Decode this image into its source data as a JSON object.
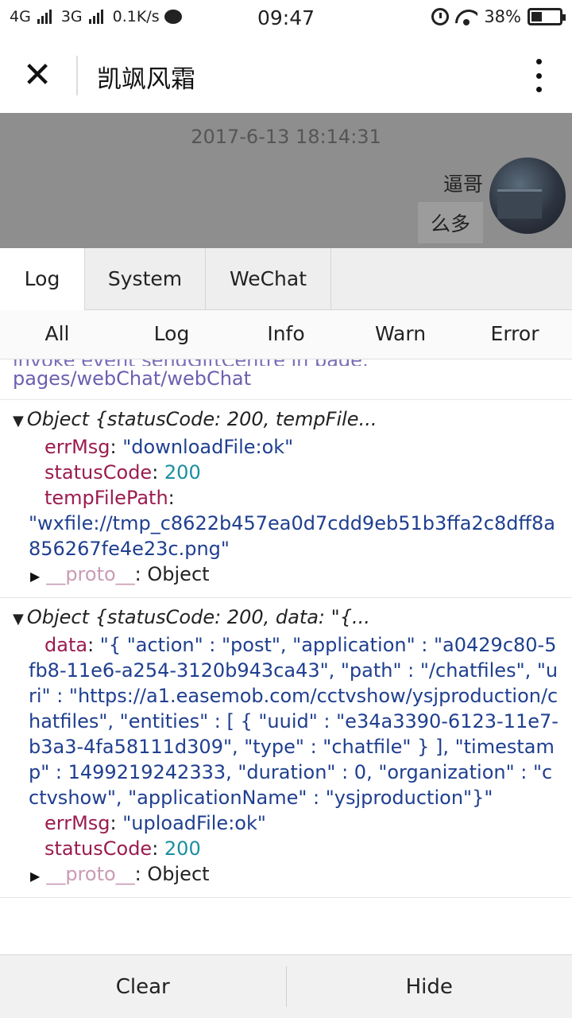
{
  "status_bar": {
    "net1": "4G",
    "net2": "3G",
    "speed": "0.1K/s",
    "time": "09:47",
    "battery": "38%",
    "battery_level": 0.38
  },
  "title_bar": {
    "close_glyph": "✕",
    "title": "凯飒风霜"
  },
  "chat": {
    "timestamp": "2017-6-13 18:14:31",
    "sender": "逼哥",
    "message": "么多"
  },
  "tabs": [
    "Log",
    "System",
    "WeChat"
  ],
  "filters": [
    "All",
    "Log",
    "Info",
    "Warn",
    "Error"
  ],
  "log": {
    "entry0": {
      "cut_text": "invoke event sendGiftCentre in page:",
      "link": "pages/webChat/webChat"
    },
    "entry1": {
      "header": "Object {statusCode: 200, tempFile...",
      "errMsg_key": "errMsg",
      "errMsg_val": "\"downloadFile:ok\"",
      "status_key": "statusCode",
      "status_val": "200",
      "path_key": "tempFilePath",
      "path_val": "\"wxfile://tmp_c8622b457ea0d7cdd9eb51b3ffa2c8dff8a856267fe4e23c.png\"",
      "proto_key": "__proto__",
      "proto_val": "Object"
    },
    "entry2": {
      "header": "Object {statusCode: 200, data: \"{...",
      "data_key": "data",
      "data_val": "\"{ \"action\" : \"post\", \"application\" : \"a0429c80-5fb8-11e6-a254-3120b943ca43\", \"path\" : \"/chatfiles\", \"uri\" : \"https://a1.easemob.com/cctvshow/ysjproduction/chatfiles\", \"entities\" : [ { \"uuid\" : \"e34a3390-6123-11e7-b3a3-4fa58111d309\", \"type\" : \"chatfile\" } ], \"timestamp\" : 1499219242333, \"duration\" : 0, \"organization\" : \"cctvshow\", \"applicationName\" : \"ysjproduction\"}\"",
      "errMsg_key": "errMsg",
      "errMsg_val": "\"uploadFile:ok\"",
      "status_key": "statusCode",
      "status_val": "200",
      "proto_key": "__proto__",
      "proto_val": "Object"
    }
  },
  "bottom": {
    "clear": "Clear",
    "hide": "Hide"
  }
}
